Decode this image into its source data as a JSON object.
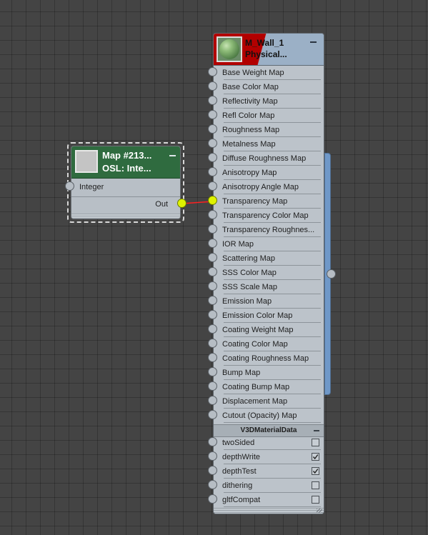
{
  "colors": {
    "wire": "#ff2020",
    "map_header": "#2f6b3f",
    "material_accent": "#b20000",
    "active_socket": "#dff200",
    "side_bar": "#6f98c8"
  },
  "map_node": {
    "title_line1": "Map #213...",
    "title_line2": "OSL: Inte...",
    "minimize_icon": "minus",
    "input_label": "Integer",
    "output_label": "Out"
  },
  "material_node": {
    "title_line1": "M_Wall_1",
    "title_line2": "Physical...",
    "minimize_icon": "minus",
    "maps": [
      "Base Weight Map",
      "Base Color Map",
      "Reflectivity Map",
      "Refl Color Map",
      "Roughness Map",
      "Metalness Map",
      "Diffuse Roughness Map",
      "Anisotropy Map",
      "Anisotropy Angle Map",
      "Transparency Map",
      "Transparency Color Map",
      "Transparency Roughnes...",
      "IOR Map",
      "Scattering Map",
      "SSS Color Map",
      "SSS Scale Map",
      "Emission Map",
      "Emission Color Map",
      "Coating Weight Map",
      "Coating Color Map",
      "Coating Roughness Map",
      "Bump Map",
      "Coating Bump Map",
      "Displacement Map",
      "Cutout (Opacity) Map"
    ],
    "connected_map": "Transparency Map",
    "section_title": "V3DMaterialData",
    "properties": [
      {
        "label": "twoSided",
        "checked": false
      },
      {
        "label": "depthWrite",
        "checked": true
      },
      {
        "label": "depthTest",
        "checked": true
      },
      {
        "label": "dithering",
        "checked": false
      },
      {
        "label": "gltfCompat",
        "checked": false
      }
    ]
  }
}
